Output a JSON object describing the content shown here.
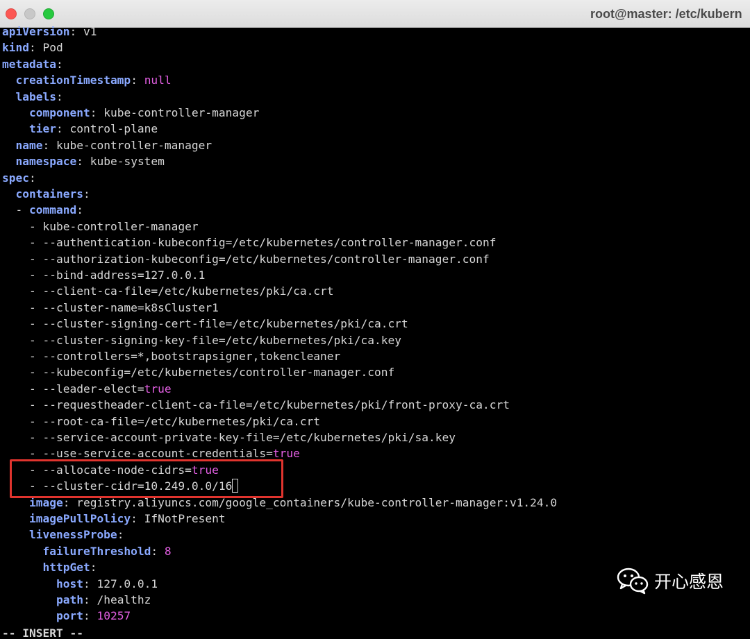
{
  "window": {
    "title": "root@master: /etc/kubern",
    "colors": {
      "close": "#fc5753",
      "minimize": "#c8c8c8",
      "maximize": "#27c93f",
      "highlight_box": "#e0342e",
      "key": "#8aa9ff",
      "literal": "#e35fe3"
    }
  },
  "editor": {
    "mode": "-- INSERT --",
    "lines": [
      {
        "key": "apiVersion",
        "value": "v1",
        "indent": 0
      },
      {
        "key": "kind",
        "value": "Pod",
        "indent": 0
      },
      {
        "key": "metadata",
        "value": "",
        "indent": 0
      },
      {
        "key": "creationTimestamp",
        "value": "null",
        "literal": true,
        "indent": 1
      },
      {
        "key": "labels",
        "value": "",
        "indent": 1
      },
      {
        "key": "component",
        "value": "kube-controller-manager",
        "indent": 2
      },
      {
        "key": "tier",
        "value": "control-plane",
        "indent": 2
      },
      {
        "key": "name",
        "value": "kube-controller-manager",
        "indent": 1
      },
      {
        "key": "namespace",
        "value": "kube-system",
        "indent": 1
      },
      {
        "key": "spec",
        "value": "",
        "indent": 0
      },
      {
        "key": "containers",
        "value": "",
        "indent": 1
      },
      {
        "prefix": "- ",
        "key": "command",
        "value": "",
        "indent": 1
      },
      {
        "item": "kube-controller-manager",
        "indent": 2
      },
      {
        "item": "--authentication-kubeconfig=/etc/kubernetes/controller-manager.conf",
        "indent": 2
      },
      {
        "item": "--authorization-kubeconfig=/etc/kubernetes/controller-manager.conf",
        "indent": 2
      },
      {
        "item": "--bind-address=127.0.0.1",
        "indent": 2
      },
      {
        "item": "--client-ca-file=/etc/kubernetes/pki/ca.crt",
        "indent": 2
      },
      {
        "item": "--cluster-name=k8sCluster1",
        "indent": 2
      },
      {
        "item": "--cluster-signing-cert-file=/etc/kubernetes/pki/ca.crt",
        "indent": 2
      },
      {
        "item": "--cluster-signing-key-file=/etc/kubernetes/pki/ca.key",
        "indent": 2
      },
      {
        "item": "--controllers=*,bootstrapsigner,tokencleaner",
        "indent": 2
      },
      {
        "item": "--kubeconfig=/etc/kubernetes/controller-manager.conf",
        "indent": 2
      },
      {
        "item": "--leader-elect=",
        "literal": "true",
        "indent": 2
      },
      {
        "item": "--requestheader-client-ca-file=/etc/kubernetes/pki/front-proxy-ca.crt",
        "indent": 2
      },
      {
        "item": "--root-ca-file=/etc/kubernetes/pki/ca.crt",
        "indent": 2
      },
      {
        "item": "--service-account-private-key-file=/etc/kubernetes/pki/sa.key",
        "indent": 2
      },
      {
        "item": "--use-service-account-credentials=",
        "literal": "true",
        "indent": 2
      },
      {
        "item": "--allocate-node-cidrs=",
        "literal": "true",
        "indent": 2
      },
      {
        "item": "--cluster-cidr=10.249.0.0/16",
        "cursor": true,
        "indent": 2
      },
      {
        "key": "image",
        "value": "registry.aliyuncs.com/google_containers/kube-controller-manager:v1.24.0",
        "indent": 2
      },
      {
        "key": "imagePullPolicy",
        "value": "IfNotPresent",
        "indent": 2
      },
      {
        "key": "livenessProbe",
        "value": "",
        "indent": 2
      },
      {
        "key": "failureThreshold",
        "value": "8",
        "literal": true,
        "indent": 3
      },
      {
        "key": "httpGet",
        "value": "",
        "indent": 3
      },
      {
        "key": "host",
        "value": "127.0.0.1",
        "indent": 4
      },
      {
        "key": "path",
        "value": "/healthz",
        "indent": 4
      },
      {
        "key": "port",
        "value": "10257",
        "literal": true,
        "indent": 4
      }
    ]
  },
  "watermark": {
    "icon": "wechat-icon",
    "text": "开心感恩"
  }
}
